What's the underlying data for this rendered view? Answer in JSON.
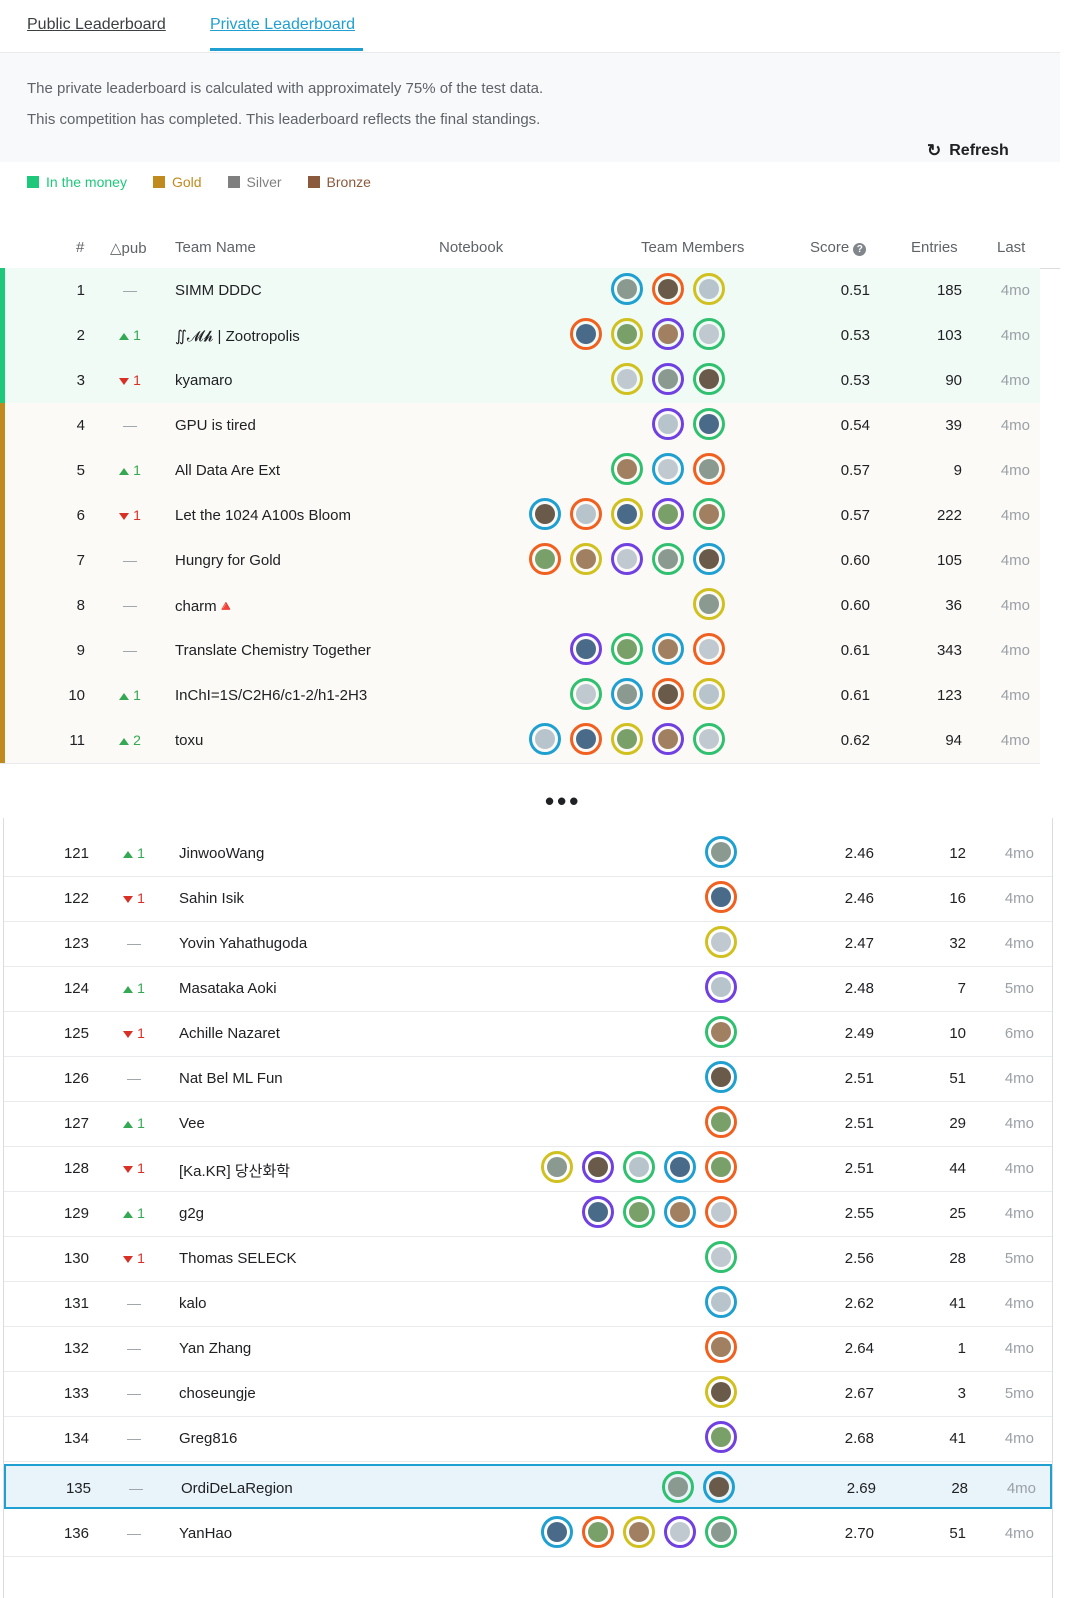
{
  "tabs": {
    "public": "Public Leaderboard",
    "private": "Private Leaderboard"
  },
  "info": {
    "line1": "The private leaderboard is calculated with approximately 75% of the test data.",
    "line2": "This competition has completed. This leaderboard reflects the final standings.",
    "refresh_label": "Refresh",
    "refresh_icon": "refresh-icon"
  },
  "legend": [
    {
      "label": "In the money",
      "color": "#1ec87a"
    },
    {
      "label": "Gold",
      "color": "#c08a1e"
    },
    {
      "label": "Silver",
      "color": "#7f7f7f"
    },
    {
      "label": "Bronze",
      "color": "#8b5a3c"
    }
  ],
  "columns": {
    "rank": "#",
    "delta": "△pub",
    "team": "Team Name",
    "notebook": "Notebook",
    "members": "Team Members",
    "score": "Score",
    "entries": "Entries",
    "last": "Last"
  },
  "ellipsis": "•••",
  "top_rows": [
    {
      "rank": "1",
      "delta": "—",
      "dir": "same",
      "team": "SIMM DDDC",
      "members": 3,
      "score": "0.51",
      "entries": "185",
      "last": "4mo",
      "tier": "money"
    },
    {
      "rank": "2",
      "delta": "1",
      "dir": "up",
      "team": "∬𝓜𝓱 | Zootropolis",
      "members": 4,
      "score": "0.53",
      "entries": "103",
      "last": "4mo",
      "tier": "money"
    },
    {
      "rank": "3",
      "delta": "1",
      "dir": "down",
      "team": "kyamaro",
      "members": 3,
      "score": "0.53",
      "entries": "90",
      "last": "4mo",
      "tier": "money"
    },
    {
      "rank": "4",
      "delta": "—",
      "dir": "same",
      "team": "GPU is tired",
      "members": 2,
      "score": "0.54",
      "entries": "39",
      "last": "4mo",
      "tier": "gold"
    },
    {
      "rank": "5",
      "delta": "1",
      "dir": "up",
      "team": "All Data Are Ext",
      "members": 3,
      "score": "0.57",
      "entries": "9",
      "last": "4mo",
      "tier": "gold"
    },
    {
      "rank": "6",
      "delta": "1",
      "dir": "down",
      "team": "Let the 1024 A100s Bloom",
      "members": 5,
      "score": "0.57",
      "entries": "222",
      "last": "4mo",
      "tier": "gold"
    },
    {
      "rank": "7",
      "delta": "—",
      "dir": "same",
      "team": "Hungry for Gold",
      "members": 5,
      "score": "0.60",
      "entries": "105",
      "last": "4mo",
      "tier": "gold"
    },
    {
      "rank": "8",
      "delta": "—",
      "dir": "same",
      "team": "charm🔺",
      "members": 1,
      "score": "0.60",
      "entries": "36",
      "last": "4mo",
      "tier": "gold"
    },
    {
      "rank": "9",
      "delta": "—",
      "dir": "same",
      "team": "Translate Chemistry Together",
      "members": 4,
      "score": "0.61",
      "entries": "343",
      "last": "4mo",
      "tier": "gold"
    },
    {
      "rank": "10",
      "delta": "1",
      "dir": "up",
      "team": "InChI=1S/C2H6/c1-2/h1-2H3",
      "members": 4,
      "score": "0.61",
      "entries": "123",
      "last": "4mo",
      "tier": "gold"
    },
    {
      "rank": "11",
      "delta": "2",
      "dir": "up",
      "team": "toxu",
      "members": 5,
      "score": "0.62",
      "entries": "94",
      "last": "4mo",
      "tier": "gold"
    }
  ],
  "bottom_rows": [
    {
      "rank": "121",
      "delta": "1",
      "dir": "up",
      "team": "JinwooWang",
      "members": 1,
      "score": "2.46",
      "entries": "12",
      "last": "4mo"
    },
    {
      "rank": "122",
      "delta": "1",
      "dir": "down",
      "team": "Sahin Isik",
      "members": 1,
      "score": "2.46",
      "entries": "16",
      "last": "4mo"
    },
    {
      "rank": "123",
      "delta": "—",
      "dir": "same",
      "team": "Yovin Yahathugoda",
      "members": 1,
      "score": "2.47",
      "entries": "32",
      "last": "4mo"
    },
    {
      "rank": "124",
      "delta": "1",
      "dir": "up",
      "team": "Masataka Aoki",
      "members": 1,
      "score": "2.48",
      "entries": "7",
      "last": "5mo"
    },
    {
      "rank": "125",
      "delta": "1",
      "dir": "down",
      "team": "Achille Nazaret",
      "members": 1,
      "score": "2.49",
      "entries": "10",
      "last": "6mo"
    },
    {
      "rank": "126",
      "delta": "—",
      "dir": "same",
      "team": "Nat Bel ML Fun",
      "members": 1,
      "score": "2.51",
      "entries": "51",
      "last": "4mo"
    },
    {
      "rank": "127",
      "delta": "1",
      "dir": "up",
      "team": "Vee",
      "members": 1,
      "score": "2.51",
      "entries": "29",
      "last": "4mo"
    },
    {
      "rank": "128",
      "delta": "1",
      "dir": "down",
      "team": "[Ka.KR] 당산화학",
      "members": 5,
      "score": "2.51",
      "entries": "44",
      "last": "4mo"
    },
    {
      "rank": "129",
      "delta": "1",
      "dir": "up",
      "team": "g2g",
      "members": 4,
      "score": "2.55",
      "entries": "25",
      "last": "4mo"
    },
    {
      "rank": "130",
      "delta": "1",
      "dir": "down",
      "team": "Thomas SELECK",
      "members": 1,
      "score": "2.56",
      "entries": "28",
      "last": "5mo"
    },
    {
      "rank": "131",
      "delta": "—",
      "dir": "same",
      "team": "kalo",
      "members": 1,
      "score": "2.62",
      "entries": "41",
      "last": "4mo"
    },
    {
      "rank": "132",
      "delta": "—",
      "dir": "same",
      "team": "Yan Zhang",
      "members": 1,
      "score": "2.64",
      "entries": "1",
      "last": "4mo"
    },
    {
      "rank": "133",
      "delta": "—",
      "dir": "same",
      "team": "choseungje",
      "members": 1,
      "score": "2.67",
      "entries": "3",
      "last": "5mo"
    },
    {
      "rank": "134",
      "delta": "—",
      "dir": "same",
      "team": "Greg816",
      "members": 1,
      "score": "2.68",
      "entries": "41",
      "last": "4mo"
    },
    {
      "rank": "135",
      "delta": "—",
      "dir": "same",
      "team": "OrdiDeLaRegion",
      "members": 2,
      "score": "2.69",
      "entries": "28",
      "last": "4mo",
      "highlight": true
    },
    {
      "rank": "136",
      "delta": "—",
      "dir": "same",
      "team": "YanHao",
      "members": 5,
      "score": "2.70",
      "entries": "51",
      "last": "4mo"
    }
  ],
  "colors": {
    "accent": "#20a0d0",
    "money_bg": "#f1fbf6",
    "gold_bg": "#fcfaf6",
    "money_bar": "#1ec87a",
    "gold_bar": "#c08a1e"
  }
}
